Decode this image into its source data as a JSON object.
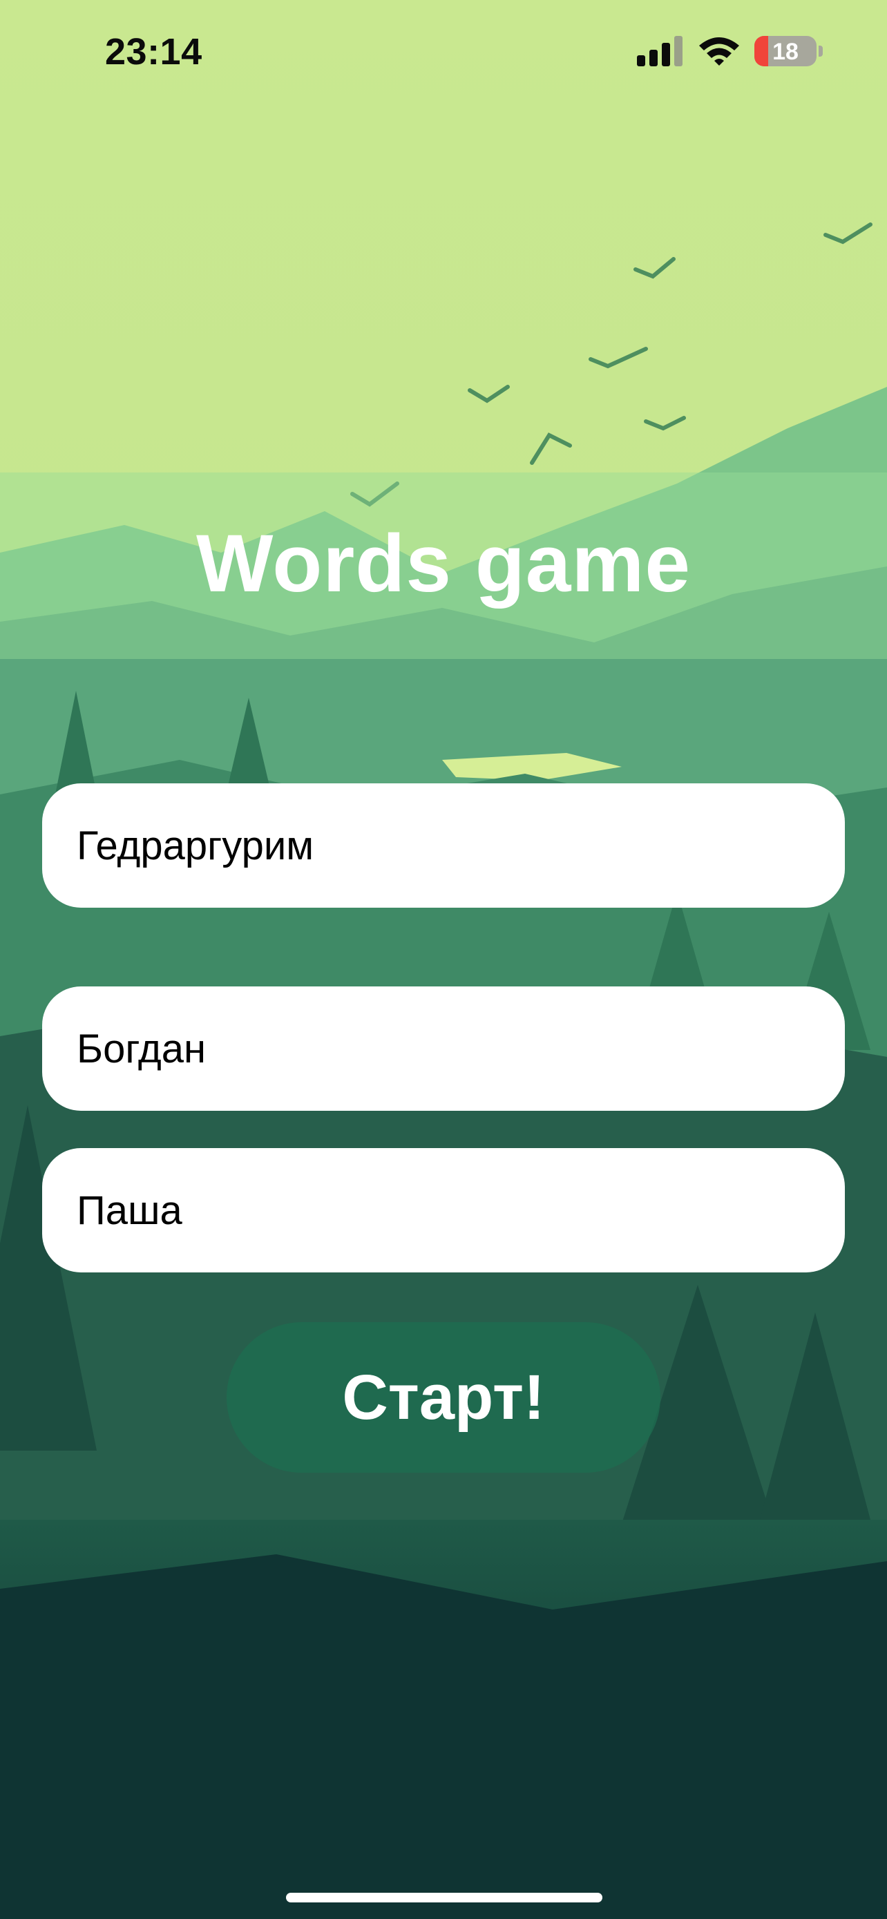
{
  "status_bar": {
    "time": "23:14",
    "battery_level": "18",
    "icons": [
      "cellular-signal-icon",
      "wifi-icon",
      "charging-battery-icon"
    ]
  },
  "background": {
    "description_icon": "forest-landscape-illustration",
    "colors": {
      "sky": "#c9e890",
      "forest_dark": "#0d2e2b",
      "accent_green": "#1e6e50"
    }
  },
  "app": {
    "title": "Words game",
    "players": [
      {
        "value": "Гедраргурим"
      },
      {
        "value": "Богдан"
      },
      {
        "value": "Паша"
      }
    ],
    "start_label": "Старт!"
  }
}
